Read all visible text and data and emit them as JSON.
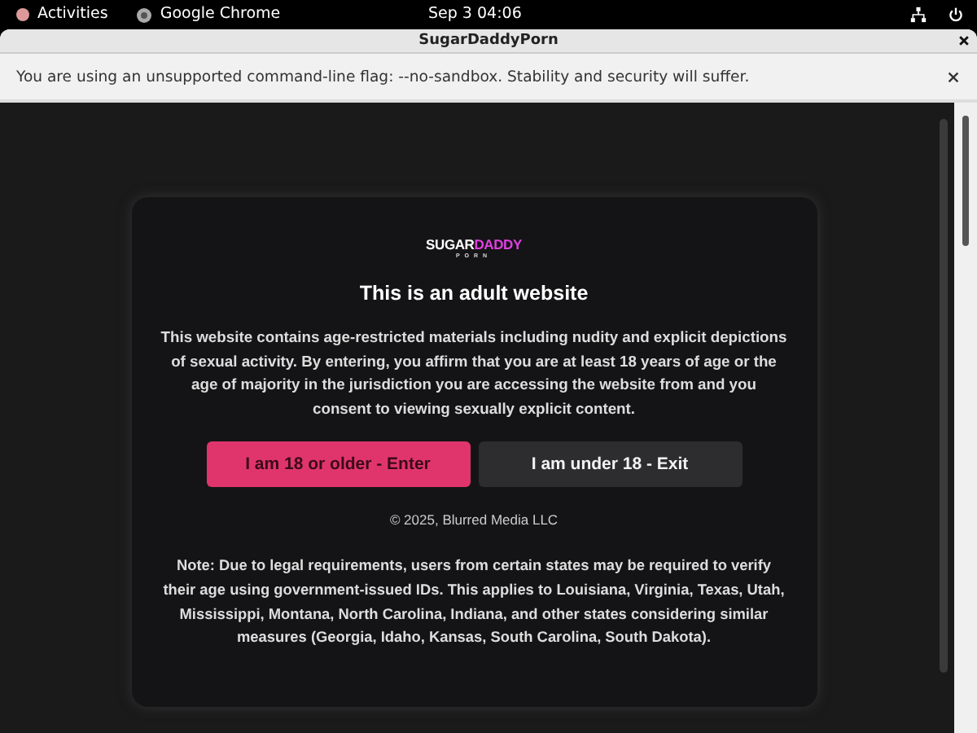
{
  "top_bar": {
    "activities": "Activities",
    "app": "Google Chrome",
    "clock": "Sep 3  04:06"
  },
  "window": {
    "title": "SugarDaddyPorn"
  },
  "infobar": {
    "message": "You are using an unsupported command-line flag: --no-sandbox. Stability and security will suffer."
  },
  "dialog": {
    "logo": {
      "first": "SUGAR",
      "second": "DADDY",
      "sub": "PORN"
    },
    "heading": "This is an adult website",
    "body": "This website contains age-restricted materials including nudity and explicit depictions of sexual activity. By entering, you affirm that you are at least 18 years of age or the age of majority in the jurisdiction you are accessing the website from and you consent to viewing sexually explicit content.",
    "buttons": [
      {
        "label": "I am 18 or older - Enter",
        "kind": "primary"
      },
      {
        "label": "I am under 18 - Exit",
        "kind": "secondary"
      }
    ],
    "copyright": "© 2025, Blurred Media LLC",
    "note": "Note: Due to legal requirements, users from certain states may be required to verify their age using government-issued IDs. This applies to Louisiana, Virginia, Texas, Utah, Mississippi, Montana, North Carolina, Indiana, and other states considering similar measures (Georgia, Idaho, Kansas, South Carolina, South Dakota)."
  }
}
